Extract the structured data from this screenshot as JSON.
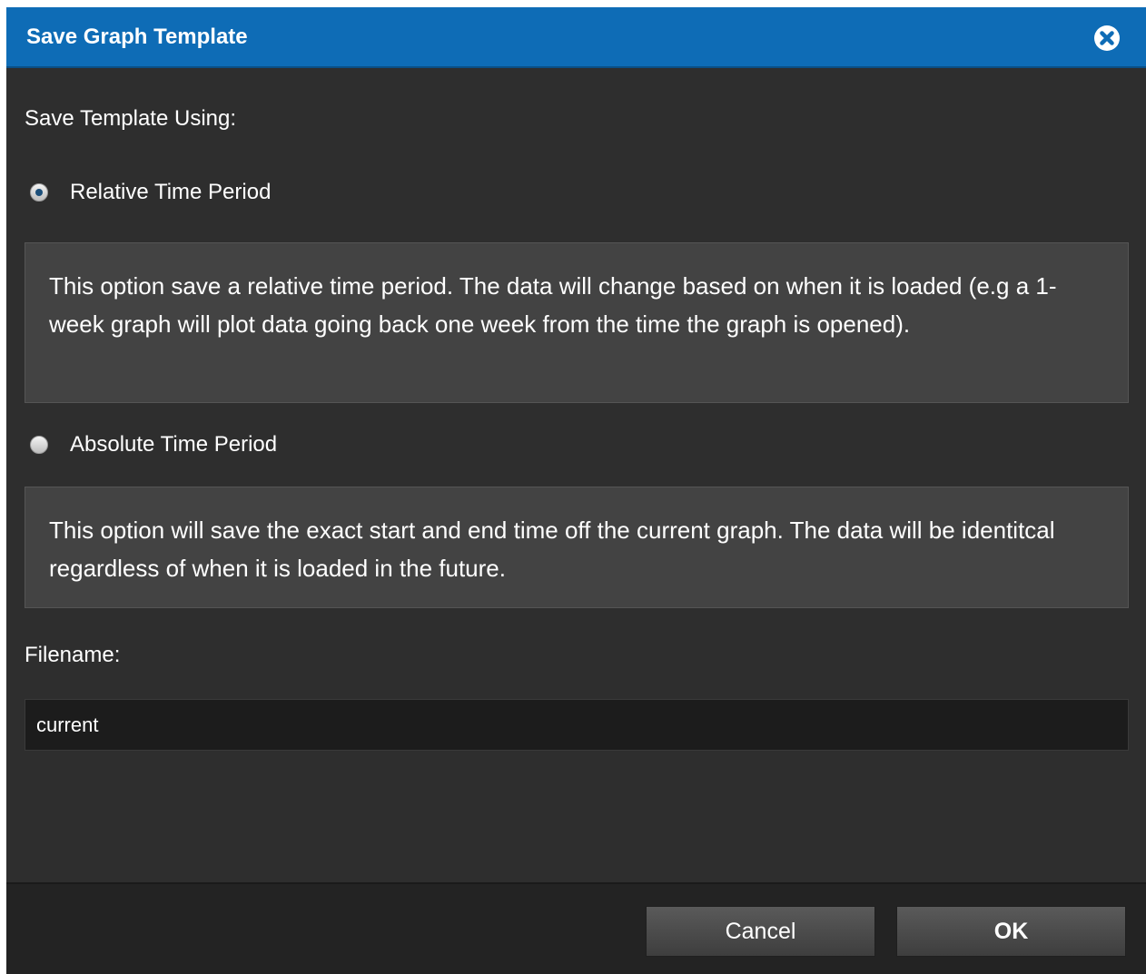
{
  "dialog": {
    "title": "Save Graph Template",
    "close_icon": "close-circle-icon",
    "accent_color": "#0e6cb6"
  },
  "form": {
    "save_using_label": "Save Template Using:",
    "options": [
      {
        "label": "Relative Time Period",
        "selected": true,
        "description": "This option save a relative time period. The data will change based on when it is loaded (e.g a 1- week graph will plot data going back one week from the time the graph is opened)."
      },
      {
        "label": "Absolute Time Period",
        "selected": false,
        "description": "This option will save the exact start and end time off the current graph. The data will be identitcal regardless of when it is loaded in the future."
      }
    ],
    "filename_label": "Filename:",
    "filename_value": "current"
  },
  "footer": {
    "cancel_label": "Cancel",
    "ok_label": "OK"
  }
}
